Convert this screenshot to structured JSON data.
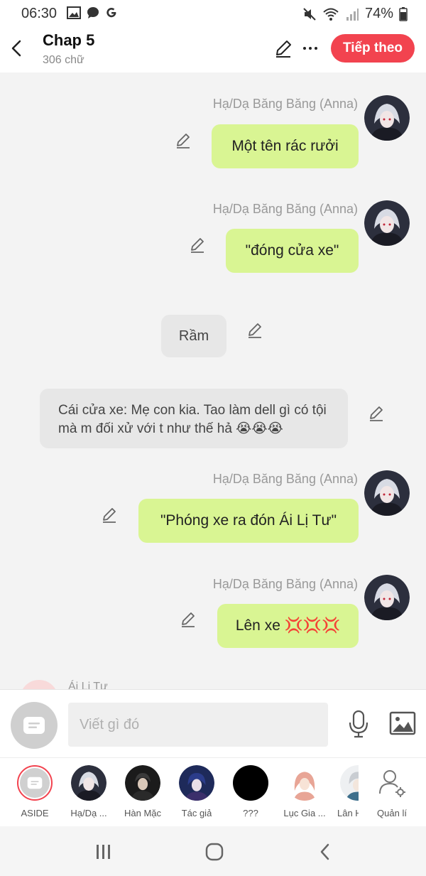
{
  "status_bar": {
    "time": "06:30",
    "battery": "74%",
    "icons": [
      "image-icon",
      "chat-bubble-icon",
      "google-icon",
      "mute-icon",
      "wifi-icon",
      "signal-icon",
      "battery-icon"
    ]
  },
  "header": {
    "title": "Chap 5",
    "word_count": "306 chữ",
    "next_label": "Tiếp theo",
    "accent_color": "#f2434f"
  },
  "messages": [
    {
      "type": "character",
      "name": "Hạ/Dạ Băng Băng (Anna)",
      "text": "Một tên rác rưởi"
    },
    {
      "type": "character",
      "name": "Hạ/Dạ Băng Băng (Anna)",
      "text": "\"đóng cửa xe\""
    },
    {
      "type": "narration",
      "text": "Rầm"
    },
    {
      "type": "aside",
      "text": "Cái cửa xe: Mẹ con kia. Tao làm dell gì có tội mà m đối xử với t như thế hả 😭😭😭"
    },
    {
      "type": "character",
      "name": "Hạ/Dạ Băng Băng (Anna)",
      "text": "\"Phóng xe ra đón Ái Lị Tư\""
    },
    {
      "type": "character",
      "name": "Hạ/Dạ Băng Băng (Anna)",
      "text": "Lên xe 💢💢💢"
    },
    {
      "type": "character_partial",
      "name": "Ái Lị Tư"
    }
  ],
  "composer": {
    "placeholder": "Viết gì đó"
  },
  "characters": [
    {
      "label": "ASIDE"
    },
    {
      "label": "Hạ/Dạ ..."
    },
    {
      "label": "Hàn Mặc"
    },
    {
      "label": "Tác giả"
    },
    {
      "label": "???"
    },
    {
      "label": "Lục Gia ..."
    },
    {
      "label": "Lân H"
    },
    {
      "label": "Quản lí"
    }
  ],
  "colors": {
    "bubble_green": "#d9f593",
    "bubble_gray": "#e7e7e7",
    "background": "#f3f3f3"
  }
}
